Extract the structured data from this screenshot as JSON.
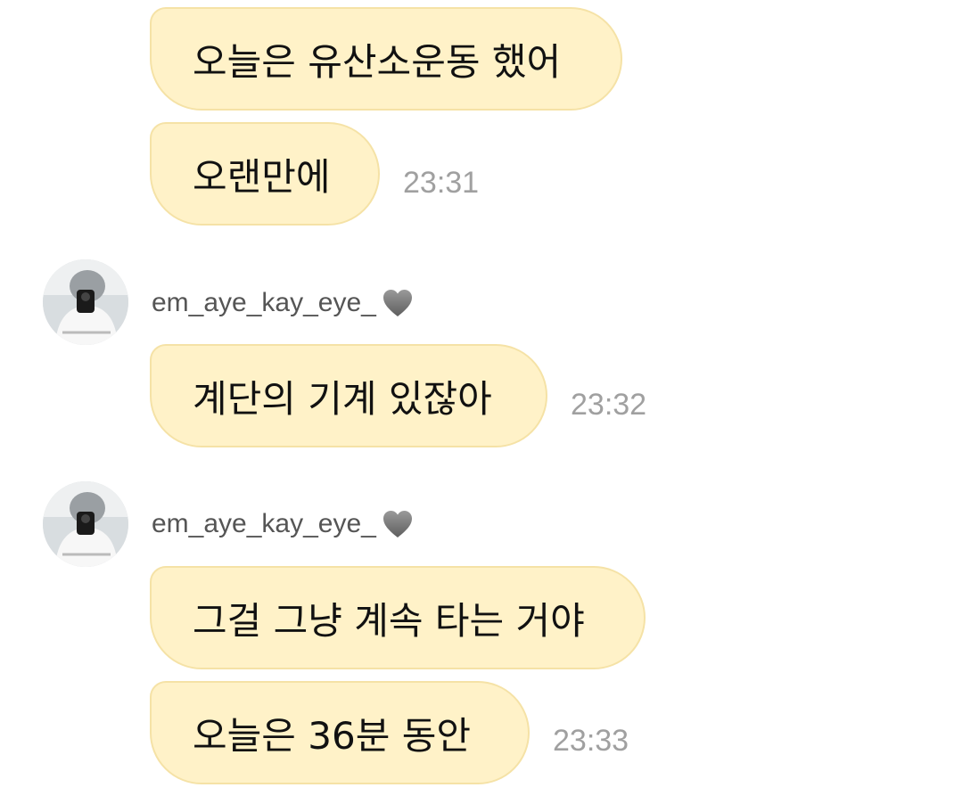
{
  "colors": {
    "bubble_fill": "#fff2c8",
    "bubble_border": "#f5e2a6",
    "timestamp": "#a0a0a0",
    "sender_name": "#555555",
    "heart": "#7a7a7a"
  },
  "messages": [
    {
      "text": "오늘은 유산소운동 했어"
    },
    {
      "text": "오랜만에",
      "time": "23:31"
    },
    {
      "sender": "em_aye_kay_eye_",
      "sender_icon": "grey-heart-icon",
      "text": "계단의 기계 있잖아",
      "time": "23:32"
    },
    {
      "sender": "em_aye_kay_eye_",
      "sender_icon": "grey-heart-icon",
      "text": "그걸 그냥 계속 타는 거야"
    },
    {
      "text": "오늘은 36분 동안",
      "time": "23:33"
    }
  ]
}
